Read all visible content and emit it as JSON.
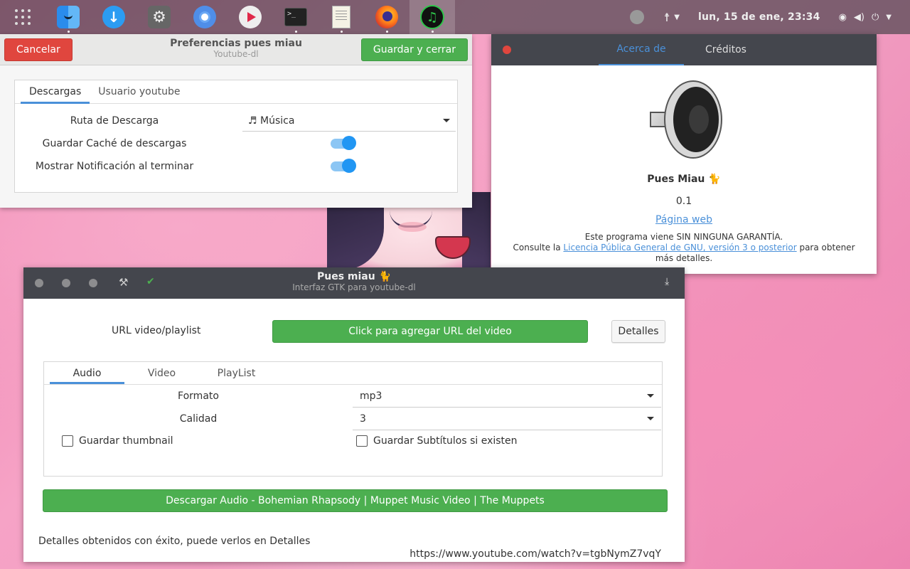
{
  "top_panel": {
    "dock_icons": [
      "app-grid-icon",
      "finder-icon",
      "downloads-icon",
      "settings-icon",
      "chromium-icon",
      "media-player-icon",
      "terminal-icon",
      "text-editor-icon",
      "firefox-icon",
      "pues-miau-icon"
    ],
    "terminal_glyph": ">_",
    "clock": "lun, 15 de ene, 23:34"
  },
  "preferences": {
    "cancel_label": "Cancelar",
    "save_label": "Guardar y cerrar",
    "title": "Preferencias pues miau",
    "subtitle": "Youtube-dl",
    "tabs": [
      "Descargas",
      "Usuario youtube"
    ],
    "rows": {
      "download_path_label": "Ruta de Descarga",
      "download_path_value": "Música",
      "cache_label": "Guardar Caché de descargas",
      "cache_on": true,
      "notify_label": "Mostrar Notificación al terminar",
      "notify_on": true
    }
  },
  "about": {
    "tabs": [
      "Acerca de",
      "Créditos"
    ],
    "app_name": "Pues Miau",
    "version": "0.1",
    "website_label": "Página web",
    "license_line1": "Este programa viene SIN NINGUNA GARANTÍA.",
    "license_prefix": "Consulte la ",
    "license_link": "Licencia Pública General de GNU, versión 3 o posterior",
    "license_suffix": " para obtener más detalles."
  },
  "main_window": {
    "title": "Pues miau",
    "subtitle": "Interfaz GTK para youtube-dl",
    "url_label": "URL video/playlist",
    "add_url_button": "Click para agregar URL del video",
    "details_button": "Detalles",
    "tabs": [
      "Audio",
      "Video",
      "PlayList"
    ],
    "format_label": "Formato",
    "format_value": "mp3",
    "quality_label": "Calidad",
    "quality_value": "3",
    "thumbnail_label": "Guardar thumbnail",
    "thumbnail_checked": false,
    "subtitles_label": "Guardar Subtítulos si existen",
    "subtitles_checked": false,
    "download_button": "Descargar Audio - Bohemian Rhapsody | Muppet Music Video | The Muppets",
    "status_message": "Detalles obtenidos con éxito, puede verlos en Detalles",
    "video_url": "https://www.youtube.com/watch?v=tgbNymZ7vqY"
  },
  "colors": {
    "accent_blue": "#4a90d9",
    "green": "#4caf50",
    "red": "#e0463e",
    "header_dark": "#44464d"
  }
}
